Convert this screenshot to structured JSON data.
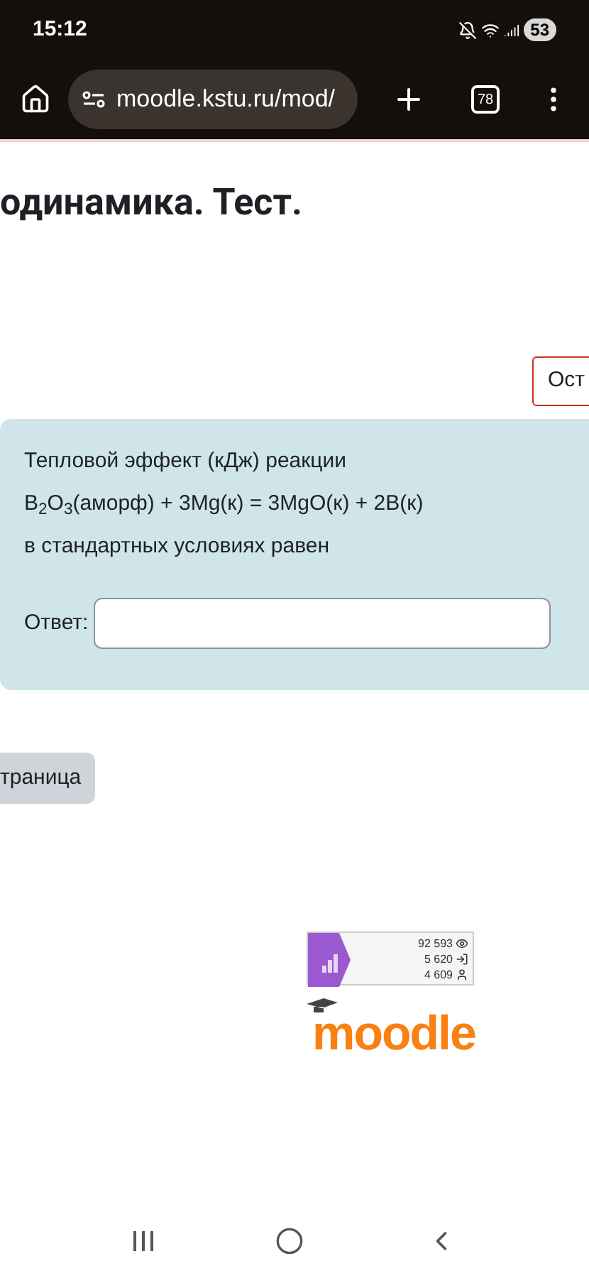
{
  "status_bar": {
    "time": "15:12",
    "battery": "53"
  },
  "browser": {
    "url": "moodle.kstu.ru/mod/",
    "tab_count": "78"
  },
  "page": {
    "title": "одинамика. Тест.",
    "timer_button": "Ост",
    "question": {
      "lines": [
        "Тепловой эффект (кДж) реакции",
        "B$_{2}$O$_{3}$(аморф) + 3Mg(к) = 3MgO(к) + 2B(к)",
        "в стандартных условиях равен"
      ],
      "answer_label": "Ответ:"
    },
    "nav_button": "траница",
    "counter": {
      "rows": [
        {
          "kind": "views",
          "value": "92 593"
        },
        {
          "kind": "logins",
          "value": "5 620"
        },
        {
          "kind": "users",
          "value": "4 609"
        }
      ]
    },
    "logo": {
      "text": "moodle"
    }
  }
}
